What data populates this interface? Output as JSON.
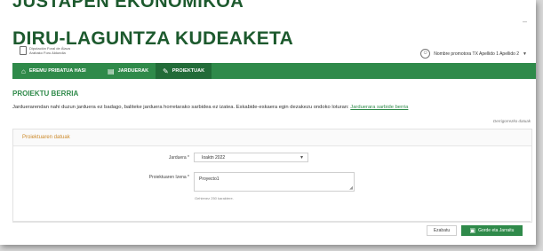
{
  "header": {
    "cut_title": "JUSTAPEN EKONOMIKOA",
    "app_title": "DIRU-LAGUNTZA KUDEAKETA",
    "logo_line1": "Diputación Foral de Álava",
    "logo_line2": "Arabako Foru Aldundia",
    "user_name": "Nombre promotora TX Apellido 1 Apellido 2",
    "minimize": "–"
  },
  "nav": {
    "items": [
      {
        "label": "EREMU PRIBATUA HASI",
        "icon": "home-icon",
        "glyph": "⌂"
      },
      {
        "label": "JARDUERAK",
        "icon": "list-icon",
        "glyph": "▤"
      },
      {
        "label": "PROIEKTUAK",
        "icon": "edit-icon",
        "glyph": "✎"
      }
    ],
    "active_index": 2
  },
  "page": {
    "title": "PROIEKTU BERRIA",
    "info_text": "Jarduerarendan nahi duzun jarduera ez badago, baliteke jarduera horretarako sarbidea ez izatea. Eskabide-eskaera egin dezakezu ondoko loturan:",
    "info_link": "Jarduerara sarbide berria",
    "required_note": "Derrigorrezko datuak"
  },
  "form": {
    "panel_title": "Proiektuaren datuak",
    "jarduera_label": "Jarduera *",
    "jarduera_value": "Ioaktn 2022",
    "izena_label": "Proiektuaren Izena *",
    "izena_value": "Proyecto1",
    "izena_hint": "Gehienez 250 karaktere."
  },
  "buttons": {
    "cancel": "Ezabatu",
    "save": "Gorde eta Jarraitu"
  },
  "colors": {
    "brand_green": "#2f8a4a",
    "active_nav": "#226b38",
    "panel_title": "#cc8a2b"
  }
}
